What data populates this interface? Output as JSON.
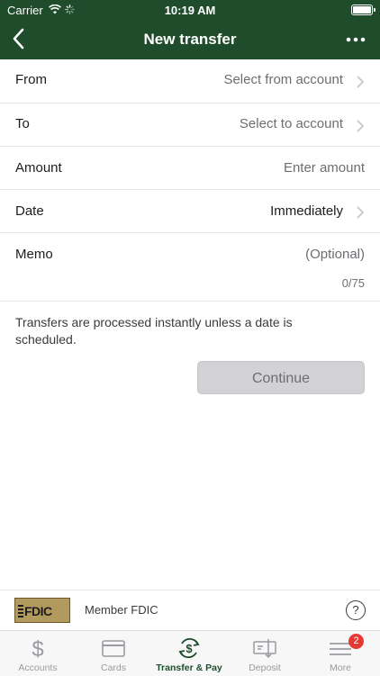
{
  "status_bar": {
    "carrier": "Carrier",
    "time": "10:19 AM"
  },
  "nav": {
    "title": "New transfer",
    "back_icon": "chevron-left-icon",
    "more_icon": "ellipsis-icon"
  },
  "form": {
    "from": {
      "label": "From",
      "value": "Select from account"
    },
    "to": {
      "label": "To",
      "value": "Select to account"
    },
    "amount": {
      "label": "Amount",
      "placeholder": "Enter amount"
    },
    "date": {
      "label": "Date",
      "value": "Immediately"
    },
    "memo": {
      "label": "Memo",
      "placeholder": "(Optional)",
      "counter": "0/75"
    }
  },
  "info_text": "Transfers are processed instantly unless a date is scheduled.",
  "continue_label": "Continue",
  "footer": {
    "logo_text": "FDIC",
    "member_text": "Member FDIC",
    "help_label": "?"
  },
  "tabs": [
    {
      "label": "Accounts",
      "icon": "dollar-icon"
    },
    {
      "label": "Cards",
      "icon": "card-icon"
    },
    {
      "label": "Transfer & Pay",
      "icon": "transfer-pay-icon"
    },
    {
      "label": "Deposit",
      "icon": "deposit-icon"
    },
    {
      "label": "More",
      "icon": "menu-icon",
      "badge": "2"
    }
  ],
  "colors": {
    "header": "#1f4d2c",
    "active_tab": "#1f4d2c",
    "badge": "#e53935"
  }
}
